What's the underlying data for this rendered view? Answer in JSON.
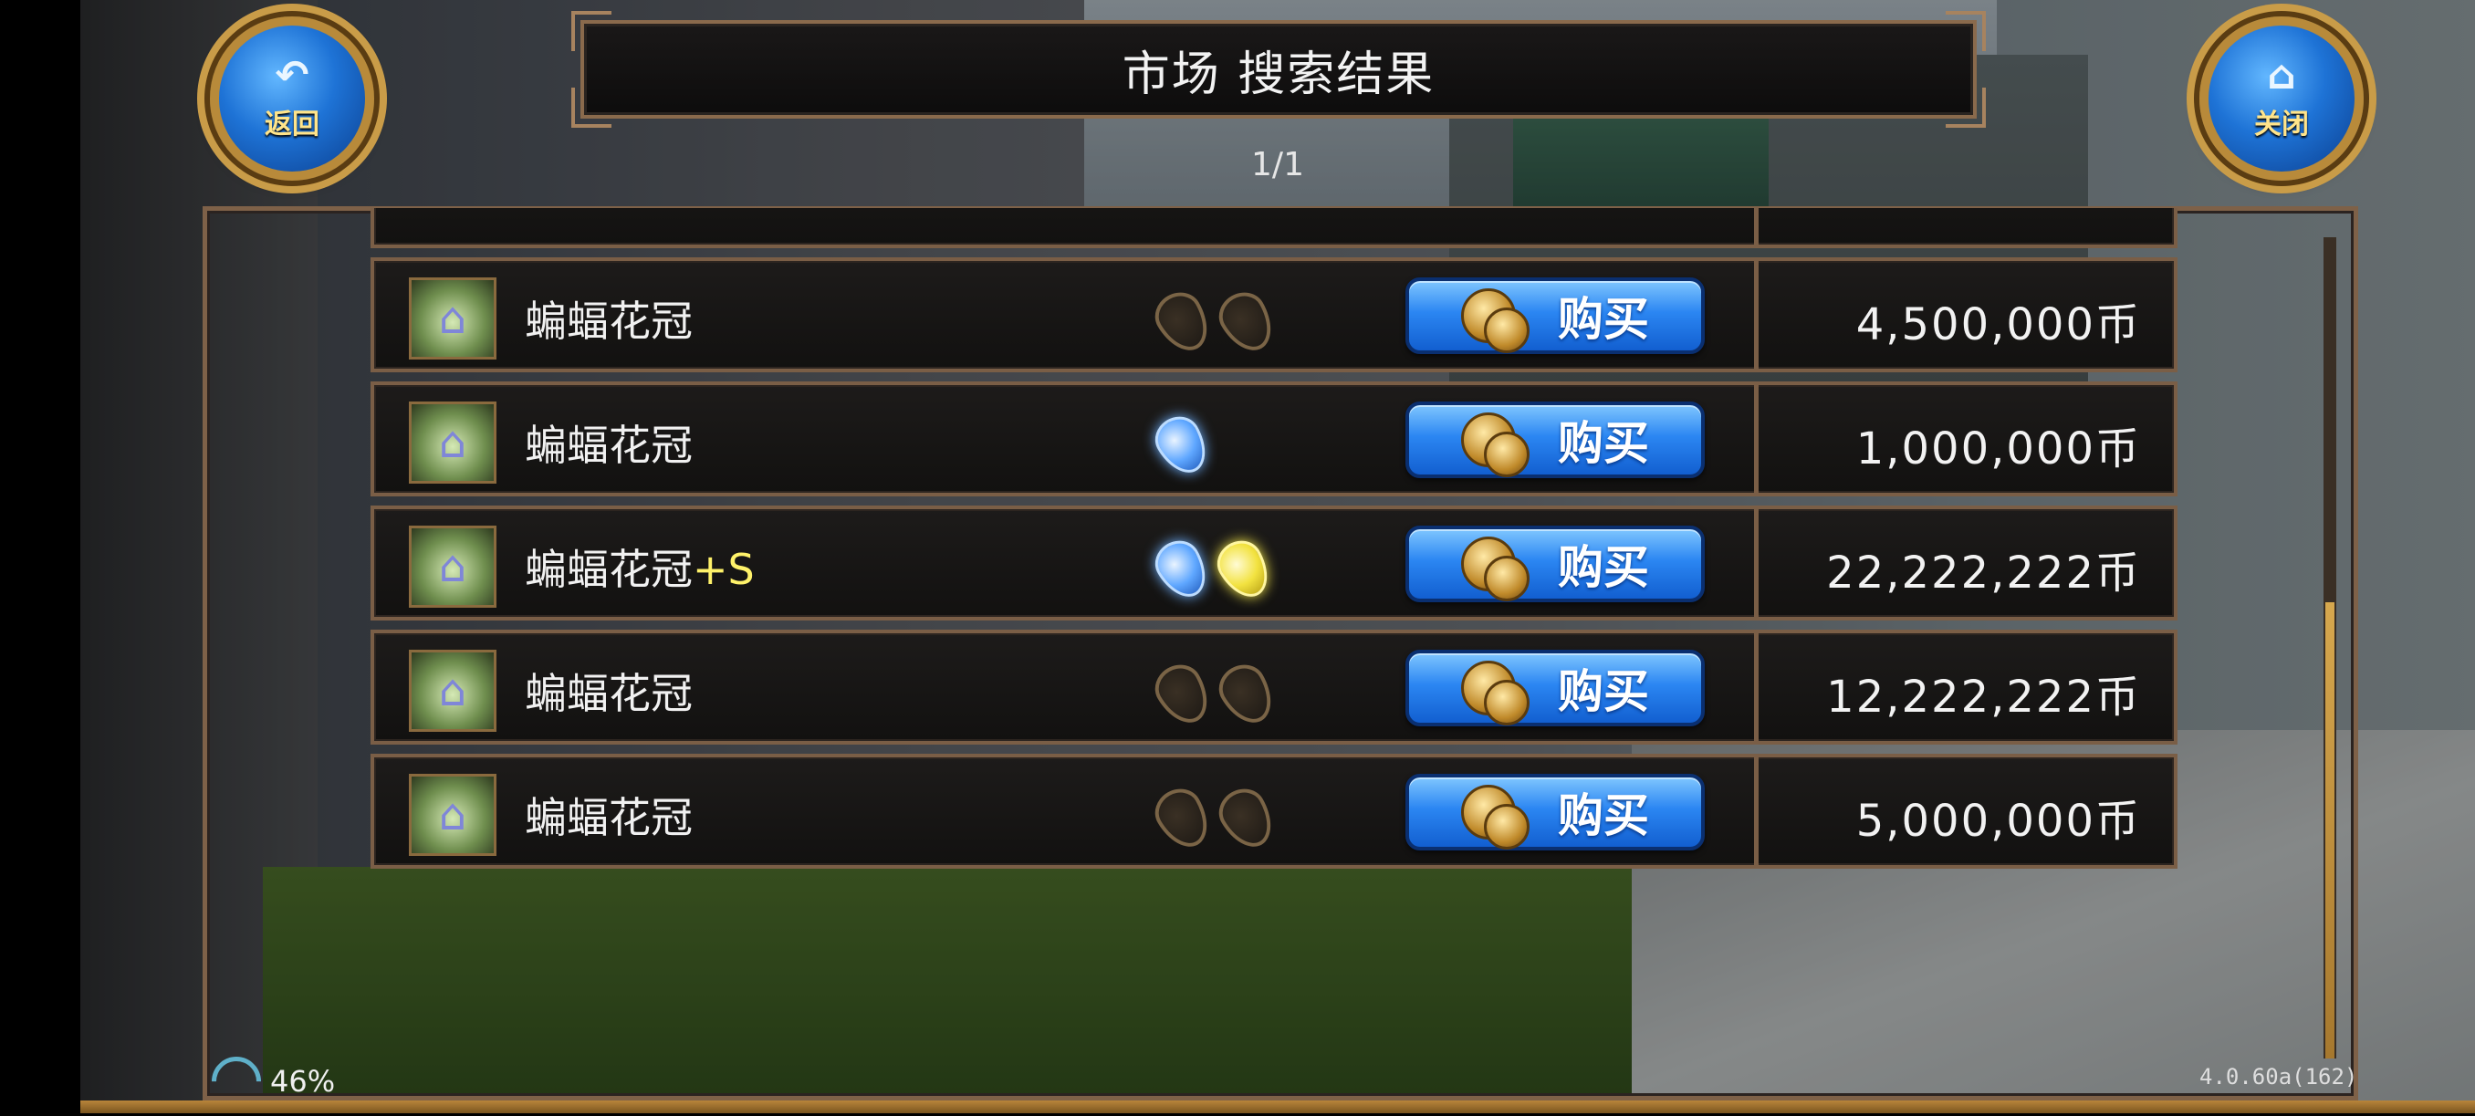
{
  "header": {
    "back_label": "返回",
    "close_label": "关闭",
    "title": "市场  搜索结果",
    "page_indicator": "1/1"
  },
  "list": {
    "buy_label": "购买",
    "items": [
      {
        "name": "蝙蝠花冠",
        "suffix": "",
        "gems": [
          "empty",
          "empty"
        ],
        "price": "4,500,000币"
      },
      {
        "name": "蝙蝠花冠",
        "suffix": "",
        "gems": [
          "blue"
        ],
        "price": "1,000,000币"
      },
      {
        "name": "蝙蝠花冠",
        "suffix": "+S",
        "gems": [
          "blue",
          "yellow"
        ],
        "price": "22,222,222币"
      },
      {
        "name": "蝙蝠花冠",
        "suffix": "",
        "gems": [
          "empty",
          "empty"
        ],
        "price": "12,222,222币"
      },
      {
        "name": "蝙蝠花冠",
        "suffix": "",
        "gems": [
          "empty",
          "empty"
        ],
        "price": "5,000,000币"
      }
    ]
  },
  "status": {
    "battery": "46%",
    "version": "4.0.60a(162)"
  },
  "colors": {
    "accent_frame": "#7a5e46",
    "buy_button": "#2b86f2",
    "suffix_text": "#fff26a"
  }
}
